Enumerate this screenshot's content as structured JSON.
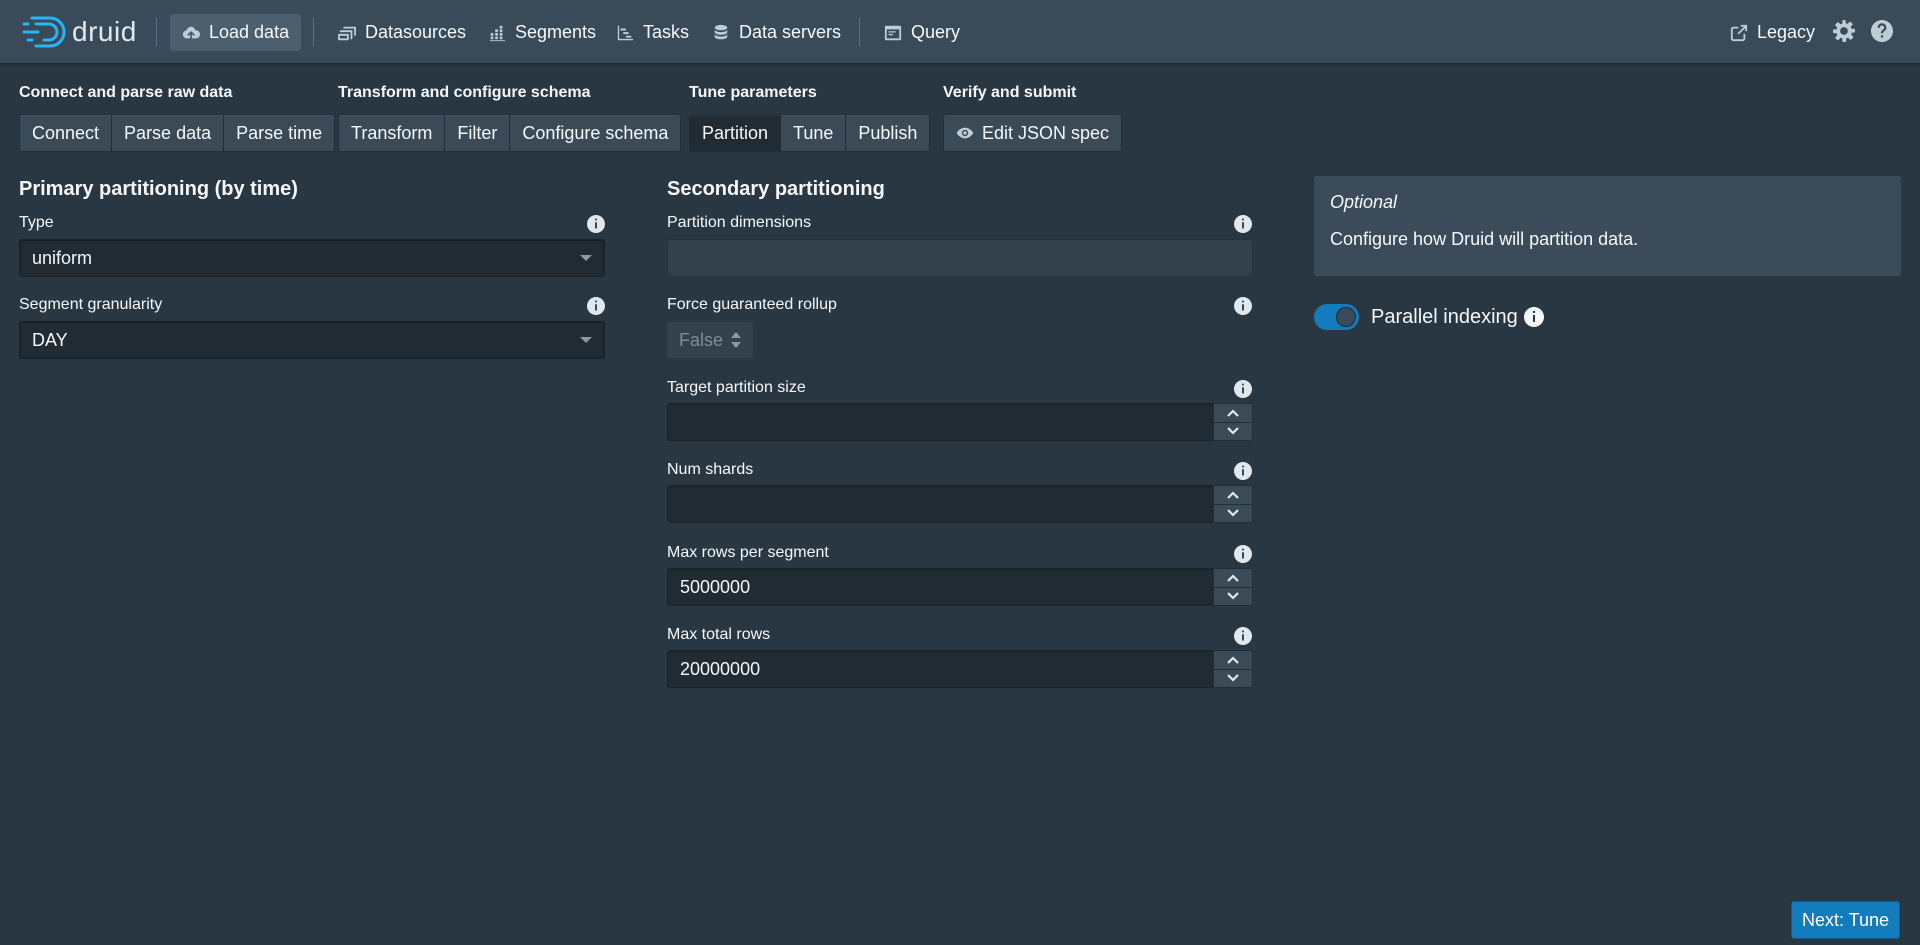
{
  "nav": {
    "brand": "druid",
    "items": [
      {
        "label": "Load data",
        "icon": "cloud-upload-icon"
      },
      {
        "label": "Datasources",
        "icon": "multi-select-icon"
      },
      {
        "label": "Segments",
        "icon": "stacked-chart-icon"
      },
      {
        "label": "Tasks",
        "icon": "gantt-chart-icon"
      },
      {
        "label": "Data servers",
        "icon": "database-icon"
      },
      {
        "label": "Query",
        "icon": "application-icon"
      }
    ],
    "legacy": "Legacy"
  },
  "steps": [
    {
      "title": "Connect and parse raw data",
      "buttons": [
        "Connect",
        "Parse data",
        "Parse time"
      ]
    },
    {
      "title": "Transform and configure schema",
      "buttons": [
        "Transform",
        "Filter",
        "Configure schema"
      ]
    },
    {
      "title": "Tune parameters",
      "buttons": [
        "Partition",
        "Tune",
        "Publish"
      ]
    },
    {
      "title": "Verify and submit",
      "buttons": [
        "Edit JSON spec"
      ]
    }
  ],
  "primary": {
    "heading": "Primary partitioning (by time)",
    "type_label": "Type",
    "type_value": "uniform",
    "granularity_label": "Segment granularity",
    "granularity_value": "DAY"
  },
  "secondary": {
    "heading": "Secondary partitioning",
    "partition_dimensions_label": "Partition dimensions",
    "partition_dimensions_value": "",
    "force_rollup_label": "Force guaranteed rollup",
    "force_rollup_value": "False",
    "target_size_label": "Target partition size",
    "target_size_value": "",
    "num_shards_label": "Num shards",
    "num_shards_value": "",
    "max_rows_segment_label": "Max rows per segment",
    "max_rows_segment_value": "5000000",
    "max_total_rows_label": "Max total rows",
    "max_total_rows_value": "20000000"
  },
  "callout": {
    "title": "Optional",
    "text": "Configure how Druid will partition data."
  },
  "parallel": {
    "label": "Parallel indexing",
    "enabled": true
  },
  "next_button": "Next: Tune",
  "colors": {
    "background": "#293742",
    "navbar": "#394b59",
    "primary": "#137cbd"
  }
}
